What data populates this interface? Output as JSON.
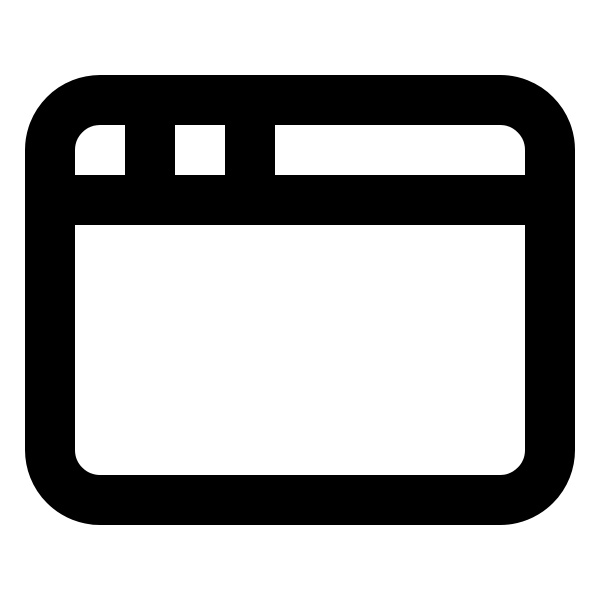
{
  "icon": {
    "name": "browser-window-icon",
    "stroke_color": "#000000",
    "background_color": "#ffffff"
  }
}
